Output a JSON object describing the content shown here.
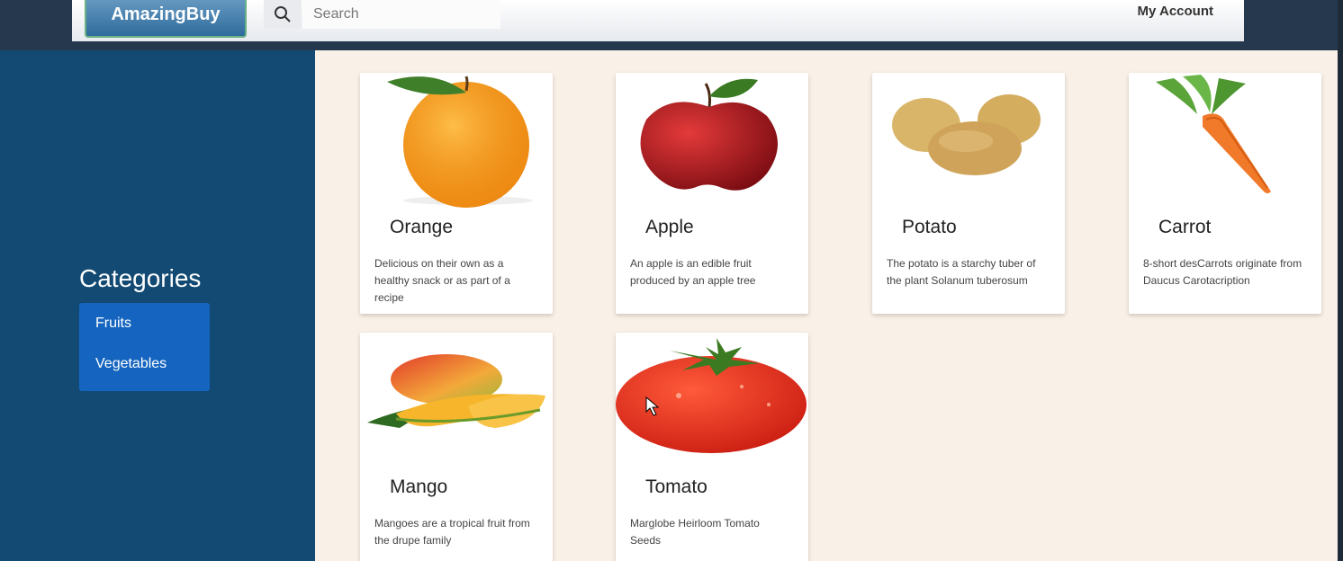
{
  "header": {
    "logo": "AmazingBuy",
    "search_placeholder": "Search",
    "account": "My Account"
  },
  "sidebar": {
    "title": "Categories",
    "items": [
      {
        "label": "Fruits"
      },
      {
        "label": "Vegetables"
      }
    ]
  },
  "products": [
    {
      "name": "Orange",
      "description": "Delicious on their own as a healthy snack or as part of a recipe",
      "image": "orange-image"
    },
    {
      "name": "Apple",
      "description": "An apple is an edible fruit produced by an apple tree",
      "image": "apple-image"
    },
    {
      "name": "Potato",
      "description": "The potato is a starchy tuber of the plant Solanum tuberosum",
      "image": "potato-image"
    },
    {
      "name": "Carrot",
      "description": "8-short desCarrots originate from Daucus Carotacription",
      "image": "carrot-image"
    },
    {
      "name": "Mango",
      "description": "Mangoes are a tropical fruit from the drupe family",
      "image": "mango-image"
    },
    {
      "name": "Tomato",
      "description": "Marglobe Heirloom Tomato Seeds",
      "image": "tomato-image"
    }
  ],
  "colors": {
    "header_bg": "#25384d",
    "sidebar_bg": "#124a73",
    "category_bg": "#1565c0",
    "main_bg": "#f9f1e7"
  }
}
